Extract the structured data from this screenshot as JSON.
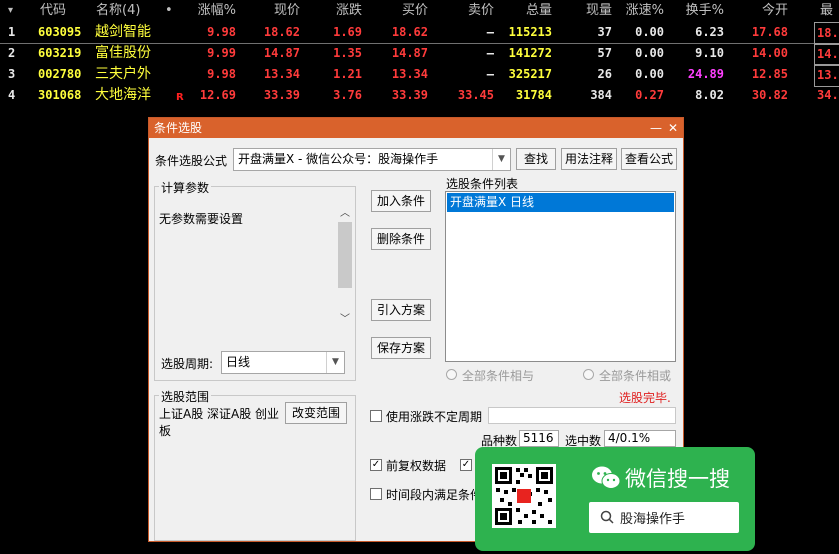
{
  "header": {
    "arrow": "▾",
    "cols": [
      "代码",
      "名称(4)",
      "•",
      "涨幅%",
      "现价",
      "涨跌",
      "买价",
      "卖价",
      "总量",
      "现量",
      "涨速%",
      "换手%",
      "今开",
      "最"
    ]
  },
  "rows": [
    {
      "idx": "1",
      "code": "603095",
      "name": "越剑智能",
      "tag": "",
      "pct": "9.98",
      "price": "18.62",
      "chg": "1.69",
      "bid": "18.62",
      "ask": "—",
      "vol": "115213",
      "cur": "37",
      "spd": "0.00",
      "turn": "6.23",
      "open": "17.68",
      "last": "18."
    },
    {
      "idx": "2",
      "code": "603219",
      "name": "富佳股份",
      "tag": "",
      "pct": "9.99",
      "price": "14.87",
      "chg": "1.35",
      "bid": "14.87",
      "ask": "—",
      "vol": "141272",
      "cur": "57",
      "spd": "0.00",
      "turn": "9.10",
      "open": "14.00",
      "last": "14."
    },
    {
      "idx": "3",
      "code": "002780",
      "name": "三夫户外",
      "tag": "",
      "pct": "9.98",
      "price": "13.34",
      "chg": "1.21",
      "bid": "13.34",
      "ask": "—",
      "vol": "325217",
      "cur": "26",
      "spd": "0.00",
      "turn": "24.89",
      "open": "12.85",
      "last": "13."
    },
    {
      "idx": "4",
      "code": "301068",
      "name": "大地海洋",
      "tag": "R",
      "pct": "12.69",
      "price": "33.39",
      "chg": "3.76",
      "bid": "33.39",
      "ask": "33.45",
      "vol": "31784",
      "cur": "384",
      "spd": "0.27",
      "turn": "8.02",
      "open": "30.82",
      "last": "34."
    }
  ],
  "colors": {
    "red": "#ff3b3b",
    "yellow": "#ffff3c",
    "cyan": "#5fd7e8",
    "white": "#e8e8e8",
    "magenta": "#ff40ff",
    "dialog_title": "#d9622c",
    "select": "#0078d7",
    "wechat": "#2eb24f"
  },
  "dialog": {
    "title": "条件选股",
    "min": "—",
    "close": "✕",
    "formula_label": "条件选股公式",
    "formula_value": "开盘满量X    - 微信公众号：股海操作手",
    "btn_find": "查找",
    "btn_usage": "用法注释",
    "btn_view": "查看公式",
    "params_group": "计算参数",
    "params_text": "无参数需要设置",
    "period_label": "选股周期:",
    "period_value": "日线",
    "btn_add": "加入条件",
    "btn_delete": "删除条件",
    "btn_import": "引入方案",
    "btn_save": "保存方案",
    "cond_list_label": "选股条件列表",
    "cond_items": [
      "开盘满量X  日线"
    ],
    "radio_and": "全部条件相与",
    "radio_or": "全部条件相或",
    "status": "选股完毕.",
    "scope_group": "选股范围",
    "scope_text": "上证A股 深证A股 创业板",
    "btn_change_scope": "改变范围",
    "use_period_label": "使用涨跌不定周期",
    "count_label": "品种数",
    "count_value": "5116",
    "selected_label": "选中数",
    "selected_value": "4/0.1%",
    "prefq_label": "前复权数据",
    "timerange_label": "时间段内满足条件"
  },
  "watermark": {
    "title": "微信搜一搜",
    "search": "股海操作手"
  }
}
